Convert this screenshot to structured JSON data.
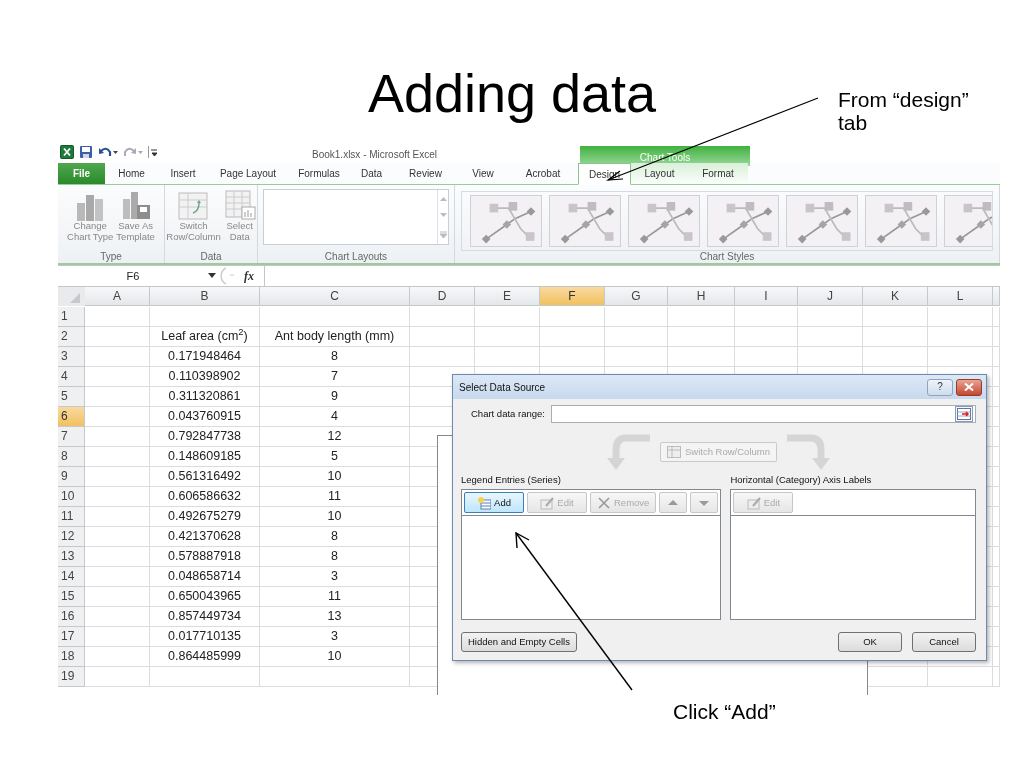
{
  "slide": {
    "title": "Adding data",
    "callouts": [
      {
        "text": "From “design” tab"
      },
      {
        "text": "Click “Add”"
      }
    ]
  },
  "excel": {
    "window_title": "Book1.xlsx - Microsoft Excel",
    "contextual_group": "Chart Tools",
    "tabs": [
      {
        "label": "File",
        "kind": "file",
        "selected": false
      },
      {
        "label": "Home",
        "kind": "normal",
        "selected": false
      },
      {
        "label": "Insert",
        "kind": "normal",
        "selected": false
      },
      {
        "label": "Page Layout",
        "kind": "normal",
        "selected": false
      },
      {
        "label": "Formulas",
        "kind": "normal",
        "selected": false
      },
      {
        "label": "Data",
        "kind": "normal",
        "selected": false
      },
      {
        "label": "Review",
        "kind": "normal",
        "selected": false
      },
      {
        "label": "View",
        "kind": "normal",
        "selected": false
      },
      {
        "label": "Acrobat",
        "kind": "normal",
        "selected": false
      },
      {
        "label": "Design",
        "kind": "contextual",
        "selected": true
      },
      {
        "label": "Layout",
        "kind": "contextual",
        "selected": false
      },
      {
        "label": "Format",
        "kind": "contextual",
        "selected": false
      }
    ],
    "ribbon_groups": [
      {
        "label": "Type",
        "kind": "buttons",
        "buttons": [
          {
            "kind": "change_type",
            "lines": [
              "Change",
              "Chart Type"
            ]
          },
          {
            "kind": "save_template",
            "lines": [
              "Save As",
              "Template"
            ]
          }
        ]
      },
      {
        "label": "Data",
        "kind": "buttons",
        "buttons": [
          {
            "kind": "switch",
            "lines": [
              "Switch",
              "Row/Column"
            ]
          },
          {
            "kind": "select",
            "lines": [
              "Select",
              "Data"
            ]
          }
        ]
      },
      {
        "label": "Chart Layouts",
        "kind": "gallery"
      },
      {
        "label": "Chart Styles",
        "kind": "styles"
      }
    ],
    "name_box": "F6",
    "fx_label": "fx",
    "columns": [
      {
        "label": "A",
        "selected": false
      },
      {
        "label": "B",
        "selected": false
      },
      {
        "label": "C",
        "selected": false
      },
      {
        "label": "D",
        "selected": false
      },
      {
        "label": "E",
        "selected": false
      },
      {
        "label": "F",
        "selected": true
      },
      {
        "label": "G",
        "selected": false
      },
      {
        "label": "H",
        "selected": false
      },
      {
        "label": "I",
        "selected": false
      },
      {
        "label": "J",
        "selected": false
      },
      {
        "label": "K",
        "selected": false
      },
      {
        "label": "L",
        "selected": false
      }
    ],
    "rows": [
      {
        "label": "1",
        "selected": false
      },
      {
        "label": "2",
        "selected": false,
        "column_b": "Leaf area (cm$^{2}$)",
        "column_c": "Ant body length (mm)"
      },
      {
        "label": "3",
        "selected": false,
        "column_b": "0.171948464",
        "column_c": "8"
      },
      {
        "label": "4",
        "selected": false,
        "column_b": "0.110398902",
        "column_c": "7"
      },
      {
        "label": "5",
        "selected": false,
        "column_b": "0.311320861",
        "column_c": "9"
      },
      {
        "label": "6",
        "selected": true,
        "column_b": "0.043760915",
        "column_c": "4"
      },
      {
        "label": "7",
        "selected": false,
        "column_b": "0.792847738",
        "column_c": "12"
      },
      {
        "label": "8",
        "selected": false,
        "column_b": "0.148609185",
        "column_c": "5"
      },
      {
        "label": "9",
        "selected": false,
        "column_b": "0.561316492",
        "column_c": "10"
      },
      {
        "label": "10",
        "selected": false,
        "column_b": "0.606586632",
        "column_c": "11"
      },
      {
        "label": "11",
        "selected": false,
        "column_b": "0.492675279",
        "column_c": "10"
      },
      {
        "label": "12",
        "selected": false,
        "column_b": "0.421370628",
        "column_c": "8"
      },
      {
        "label": "13",
        "selected": false,
        "column_b": "0.578887918",
        "column_c": "8"
      },
      {
        "label": "14",
        "selected": false,
        "column_b": "0.048658714",
        "column_c": "3"
      },
      {
        "label": "15",
        "selected": false,
        "column_b": "0.650043965",
        "column_c": "11"
      },
      {
        "label": "16",
        "selected": false,
        "column_b": "0.857449734",
        "column_c": "13"
      },
      {
        "label": "17",
        "selected": false,
        "column_b": "0.017710135",
        "column_c": "3"
      },
      {
        "label": "18",
        "selected": false,
        "column_b": "0.864485999",
        "column_c": "10"
      },
      {
        "label": "19",
        "selected": false
      }
    ],
    "dialog": {
      "title": "Select Data Source",
      "help_label": "?",
      "range_label": "Chart data range:",
      "switch_button": {
        "label": "Switch Row/Column",
        "disabled": true
      },
      "series_panel": {
        "label": "Legend Entries (Series)",
        "buttons": [
          {
            "kind": "add",
            "label": "Add",
            "disabled": false
          },
          {
            "kind": "edit",
            "label": "Edit",
            "disabled": true
          },
          {
            "kind": "remove",
            "label": "Remove",
            "disabled": true
          },
          {
            "kind": "up",
            "disabled": true
          },
          {
            "kind": "down",
            "disabled": true
          }
        ]
      },
      "category_panel": {
        "label": "Horizontal (Category) Axis Labels",
        "buttons": [
          {
            "kind": "edit",
            "label": "Edit",
            "disabled": true
          }
        ]
      },
      "footer_buttons": [
        {
          "kind": "left",
          "label": "Hidden and Empty Cells"
        },
        {
          "kind": "right",
          "label": "OK"
        },
        {
          "kind": "right",
          "label": "Cancel"
        }
      ]
    }
  }
}
